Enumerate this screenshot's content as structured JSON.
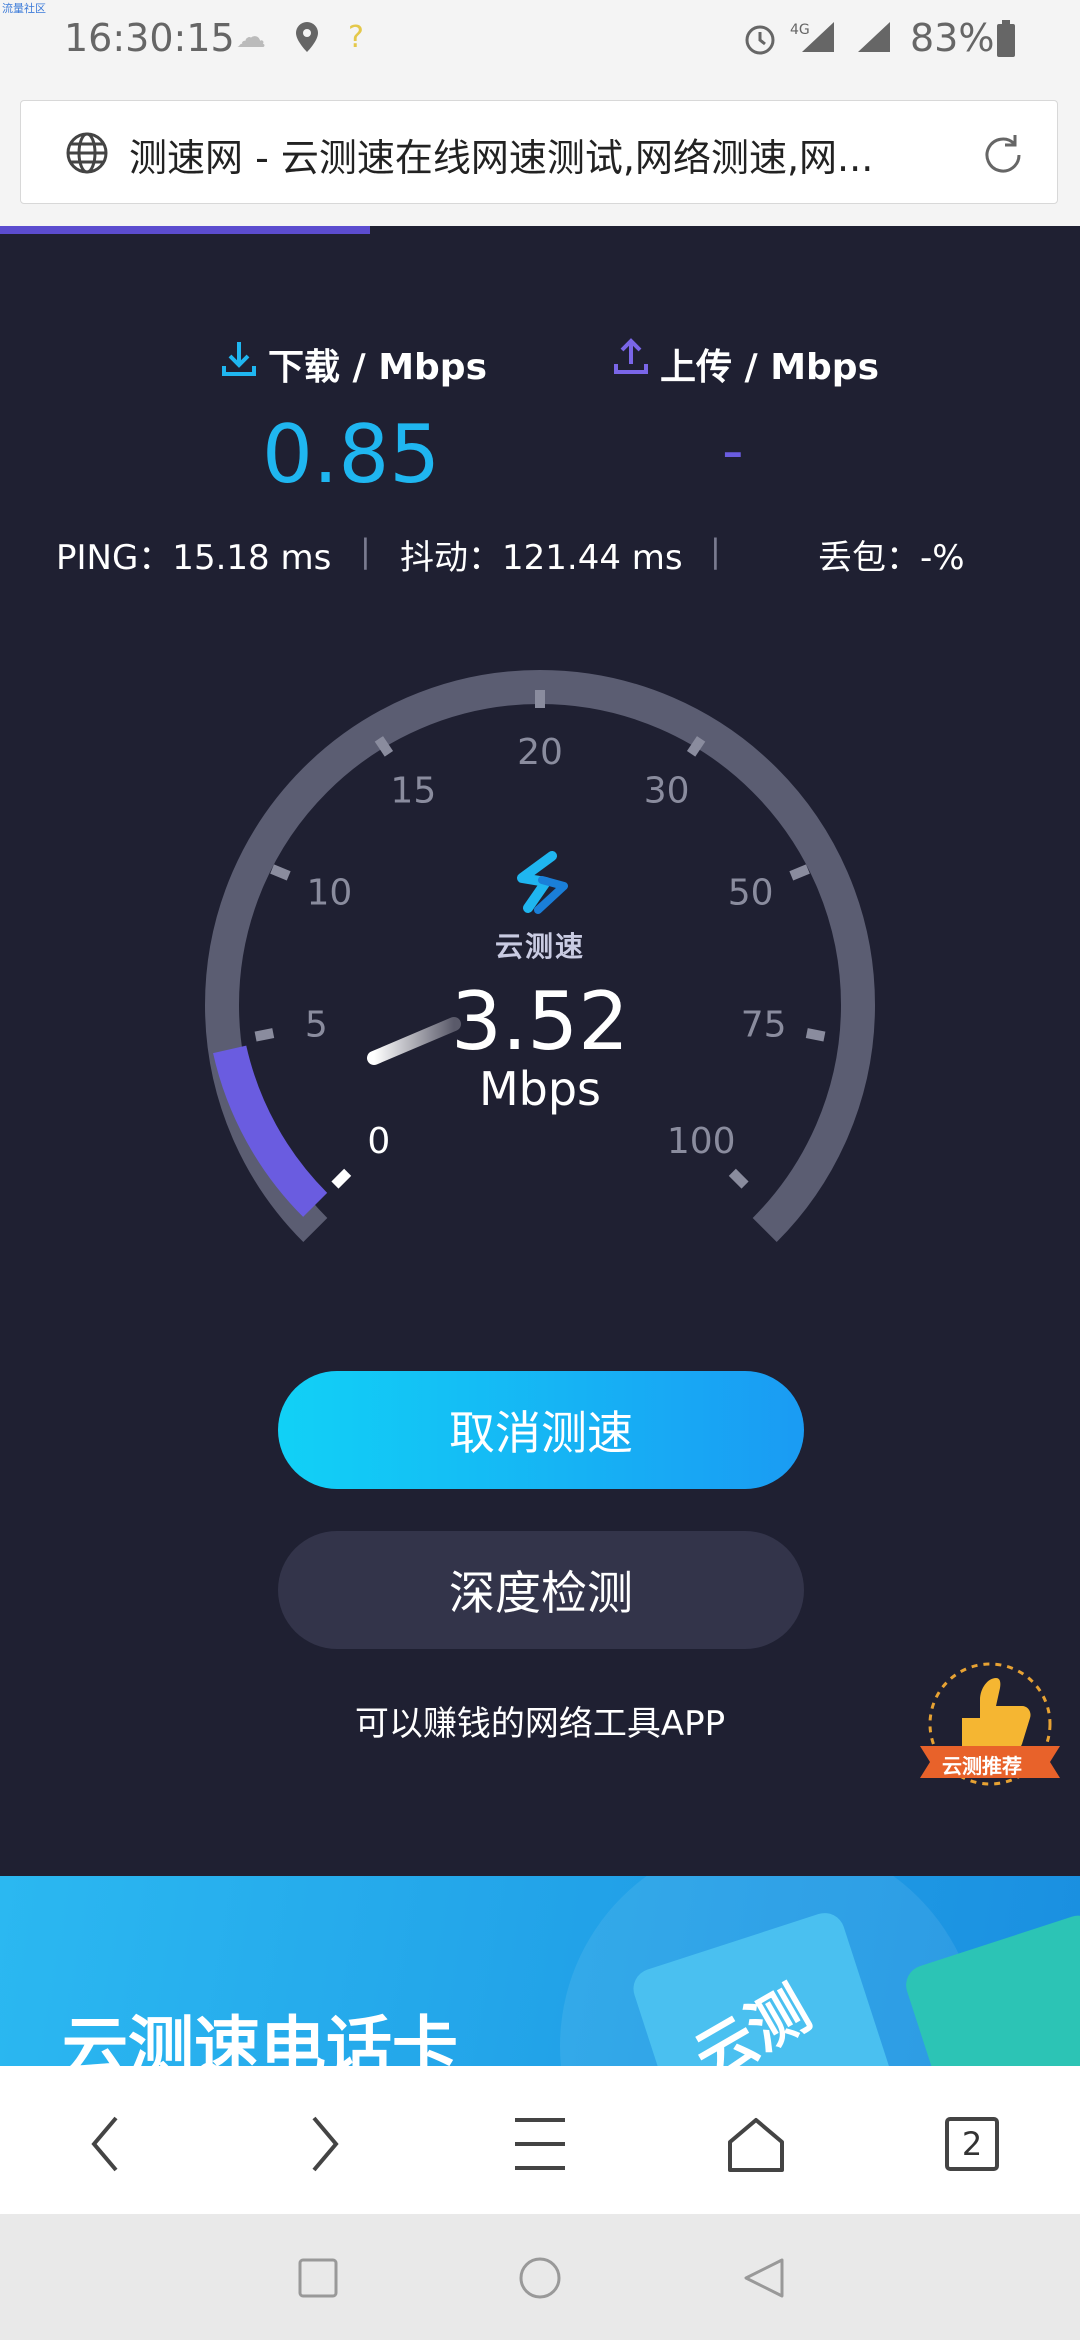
{
  "status_bar": {
    "watermark": "流量社区",
    "time": "16:30:15",
    "network": "4G",
    "battery": "83%"
  },
  "address_bar": {
    "title": "测速网 - 云测速在线网速测试,网络测速,网..."
  },
  "speed": {
    "download_label": "下载 / Mbps",
    "download_value": "0.85",
    "upload_label": "上传 / Mbps",
    "upload_value": "-",
    "ping": "PING：15.18 ms",
    "jitter": "抖动：121.44 ms",
    "loss": "丢包：-%",
    "separator": "|"
  },
  "gauge": {
    "logo_text": "云测速",
    "current": "3.52",
    "unit": "Mbps",
    "ticks": [
      "0",
      "5",
      "10",
      "15",
      "20",
      "30",
      "50",
      "75",
      "100"
    ],
    "progress_fraction": 0.12
  },
  "buttons": {
    "cancel": "取消测速",
    "deep": "深度检测"
  },
  "promo_text": "可以赚钱的网络工具APP",
  "badge_text": "云测推荐",
  "banner": {
    "title": "云测速电话卡",
    "side_text": "云测"
  },
  "nav": {
    "tab_count": "2"
  },
  "colors": {
    "background": "#1f2032",
    "accent_blue": "#1fb6f0",
    "accent_purple": "#6a5ce0"
  }
}
